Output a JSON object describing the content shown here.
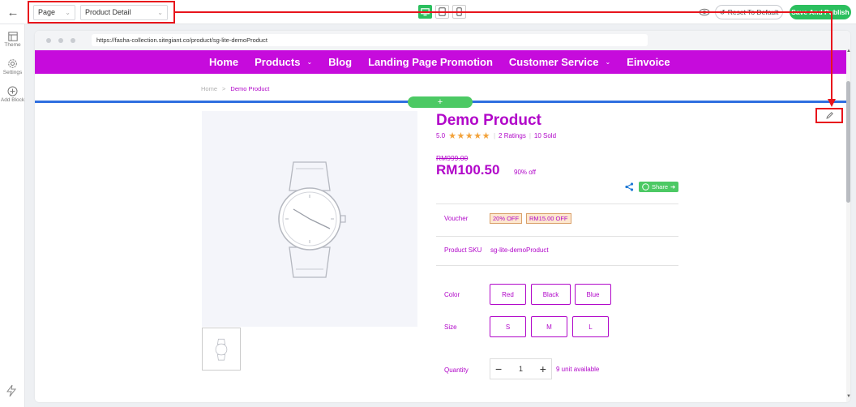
{
  "editor": {
    "page_select": "Page",
    "template_select": "Product Detail",
    "reset_label": "Reset To Default",
    "publish_label": "Save And Publish"
  },
  "rail": {
    "theme": "Theme",
    "settings": "Settings",
    "add_block": "Add Block"
  },
  "browser": {
    "url": "https://fasha-collection.sitegiant.co/product/sg-lite-demoProduct"
  },
  "nav": {
    "items": [
      "Home",
      "Products",
      "Blog",
      "Landing Page Promotion",
      "Customer Service",
      "Einvoice"
    ]
  },
  "breadcrumb": {
    "home": "Home",
    "sep": ">",
    "current": "Demo Product"
  },
  "section": {
    "add_symbol": "+"
  },
  "product": {
    "title": "Demo Product",
    "rating_value": "5.0",
    "stars": "★★★★★",
    "ratings_count": "2 Ratings",
    "sold": "10 Sold",
    "original_price": "RM999.00",
    "price": "RM100.50",
    "discount": "90% off",
    "share_label": "Share",
    "voucher_label": "Voucher",
    "vouchers": [
      "20% OFF",
      "RM15.00 OFF"
    ],
    "sku_label": "Product SKU",
    "sku_value": "sg-lite-demoProduct",
    "color_label": "Color",
    "colors": [
      "Red",
      "Black",
      "Blue"
    ],
    "size_label": "Size",
    "sizes": [
      "S",
      "M",
      "L"
    ],
    "quantity_label": "Quantity",
    "quantity_value": "1",
    "minus": "−",
    "plus": "+",
    "available": "9 unit available"
  },
  "colors": {
    "brand": "#c60bdc",
    "accent_green": "#2bbf5e",
    "highlight_red": "#e8141c",
    "section_blue": "#2f6fe0"
  }
}
